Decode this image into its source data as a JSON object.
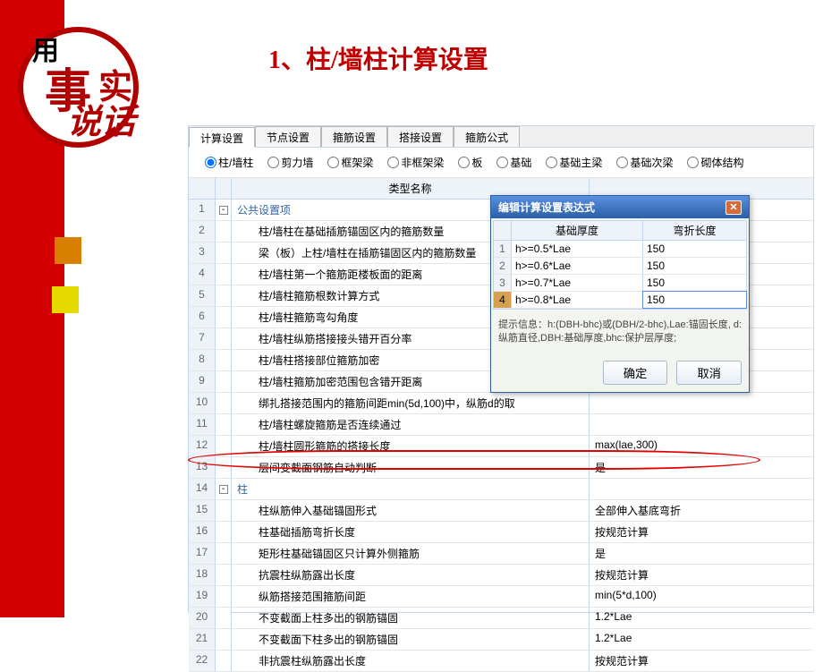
{
  "page_title": "1、柱/墙柱计算设置",
  "logo": {
    "t1": "用",
    "t2": "事",
    "t3": "实",
    "t4": "说话"
  },
  "tabs": [
    "计算设置",
    "节点设置",
    "箍筋设置",
    "搭接设置",
    "箍筋公式"
  ],
  "active_tab": 0,
  "radios": [
    "柱/墙柱",
    "剪力墙",
    "框架梁",
    "非框架梁",
    "板",
    "基础",
    "基础主梁",
    "基础次梁",
    "砌体结构"
  ],
  "selected_radio": 0,
  "grid_header_name": "类型名称",
  "rows": [
    {
      "n": 1,
      "expand": true,
      "group": true,
      "name": "公共设置项",
      "val": ""
    },
    {
      "n": 2,
      "indent": 2,
      "name": "柱/墙柱在基础插筋锚固区内的箍筋数量",
      "val": ""
    },
    {
      "n": 3,
      "indent": 2,
      "name": "梁（板）上柱/墙柱在插筋锚固区内的箍筋数量",
      "val": ""
    },
    {
      "n": 4,
      "indent": 2,
      "name": "柱/墙柱第一个箍筋距楼板面的距离",
      "val": ""
    },
    {
      "n": 5,
      "indent": 2,
      "name": "柱/墙柱箍筋根数计算方式",
      "val": ""
    },
    {
      "n": 6,
      "indent": 2,
      "name": "柱/墙柱箍筋弯勾角度",
      "val": ""
    },
    {
      "n": 7,
      "indent": 2,
      "name": "柱/墙柱纵筋搭接接头错开百分率",
      "val": ""
    },
    {
      "n": 8,
      "indent": 2,
      "name": "柱/墙柱搭接部位箍筋加密",
      "val": ""
    },
    {
      "n": 9,
      "indent": 2,
      "name": "柱/墙柱箍筋加密范围包含错开距离",
      "val": ""
    },
    {
      "n": 10,
      "indent": 2,
      "name": "绑扎搭接范围内的箍筋间距min(5d,100)中，纵筋d的取",
      "val": ""
    },
    {
      "n": 11,
      "indent": 2,
      "name": "柱/墙柱螺旋箍筋是否连续通过",
      "val": ""
    },
    {
      "n": 12,
      "indent": 2,
      "name": "柱/墙柱圆形箍筋的搭接长度",
      "val": "max(lae,300)"
    },
    {
      "n": 13,
      "indent": 2,
      "name": "层间变截面钢筋自动判断",
      "val": "是"
    },
    {
      "n": 14,
      "expand": true,
      "group": true,
      "name": "柱",
      "val": ""
    },
    {
      "n": 15,
      "indent": 2,
      "name": "柱纵筋伸入基础锚固形式",
      "val": "全部伸入基底弯折"
    },
    {
      "n": 16,
      "indent": 2,
      "name": "柱基础插筋弯折长度",
      "val": "按规范计算"
    },
    {
      "n": 17,
      "indent": 2,
      "name": "矩形柱基础锚固区只计算外侧箍筋",
      "val": "是"
    },
    {
      "n": 18,
      "indent": 2,
      "name": "抗震柱纵筋露出长度",
      "val": "按规范计算"
    },
    {
      "n": 19,
      "indent": 2,
      "name": "纵筋搭接范围箍筋间距",
      "val": "min(5*d,100)"
    },
    {
      "n": 20,
      "indent": 2,
      "name": "不变截面上柱多出的钢筋锚固",
      "val": "1.2*Lae"
    },
    {
      "n": 21,
      "indent": 2,
      "name": "不变截面下柱多出的钢筋锚固",
      "val": "1.2*Lae"
    },
    {
      "n": 22,
      "indent": 2,
      "name": "非抗震柱纵筋露出长度",
      "val": "按规范计算"
    }
  ],
  "dialog": {
    "title": "编辑计算设置表达式",
    "col1": "基础厚度",
    "col2": "弯折长度",
    "rows": [
      {
        "n": 1,
        "cond": "h>=0.5*Lae",
        "val": "150"
      },
      {
        "n": 2,
        "cond": "h>=0.6*Lae",
        "val": "150"
      },
      {
        "n": 3,
        "cond": "h>=0.7*Lae",
        "val": "150"
      },
      {
        "n": 4,
        "cond": "h>=0.8*Lae",
        "val": "150",
        "sel": true
      }
    ],
    "hint": "提示信息：h:(DBH-bhc)或(DBH/2-bhc),Lae:锚固长度, d:纵筋直径,DBH:基础厚度,bhc:保护层厚度;",
    "ok": "确定",
    "cancel": "取消"
  }
}
